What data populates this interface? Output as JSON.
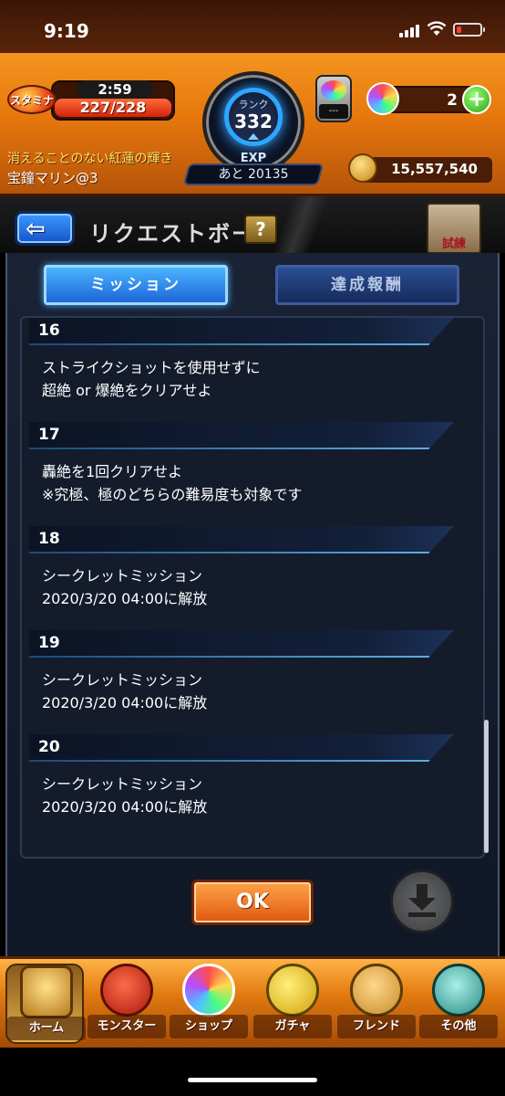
{
  "status_bar": {
    "time": "9:19"
  },
  "header": {
    "stamina_label": "スタミナ",
    "stamina_timer": "2:59",
    "stamina_value": "227/228",
    "rank_label": "ランク",
    "rank_value": "332",
    "exp_label": "EXP",
    "exp_remaining": "あと 20135",
    "ticket_slot": "---",
    "orb_count": "2",
    "orb_add": "+",
    "title_text": "消えることのない紅蓮の輝き",
    "username": "宝鐘マリン@3",
    "coins": "15,557,540"
  },
  "titlebar": {
    "back_glyph": "⇦",
    "title": "リクエストボード",
    "help": "?",
    "event_label": "試練"
  },
  "tabs": [
    {
      "label": "ミッション",
      "active": true
    },
    {
      "label": "達成報酬",
      "active": false
    }
  ],
  "missions": [
    {
      "number": "16",
      "line1": "ストライクショットを使用せずに",
      "line2": "超絶 or 爆絶をクリアせよ"
    },
    {
      "number": "17",
      "line1": "轟絶を1回クリアせよ",
      "line2": "※究極、極のどちらの難易度も対象です"
    },
    {
      "number": "18",
      "line1": "シークレットミッション",
      "line2": "2020/3/20 04:00に解放"
    },
    {
      "number": "19",
      "line1": "シークレットミッション",
      "line2": "2020/3/20 04:00に解放"
    },
    {
      "number": "20",
      "line1": "シークレットミッション",
      "line2": "2020/3/20 04:00に解放"
    }
  ],
  "buttons": {
    "ok": "OK"
  },
  "nav": [
    {
      "label": "ホーム",
      "icon": "home-icon"
    },
    {
      "label": "モンスター",
      "icon": "monster-icon"
    },
    {
      "label": "ショップ",
      "icon": "shop-orb-icon"
    },
    {
      "label": "ガチャ",
      "icon": "gacha-egg-icon"
    },
    {
      "label": "フレンド",
      "icon": "friend-icon"
    },
    {
      "label": "その他",
      "icon": "other-icon"
    }
  ]
}
